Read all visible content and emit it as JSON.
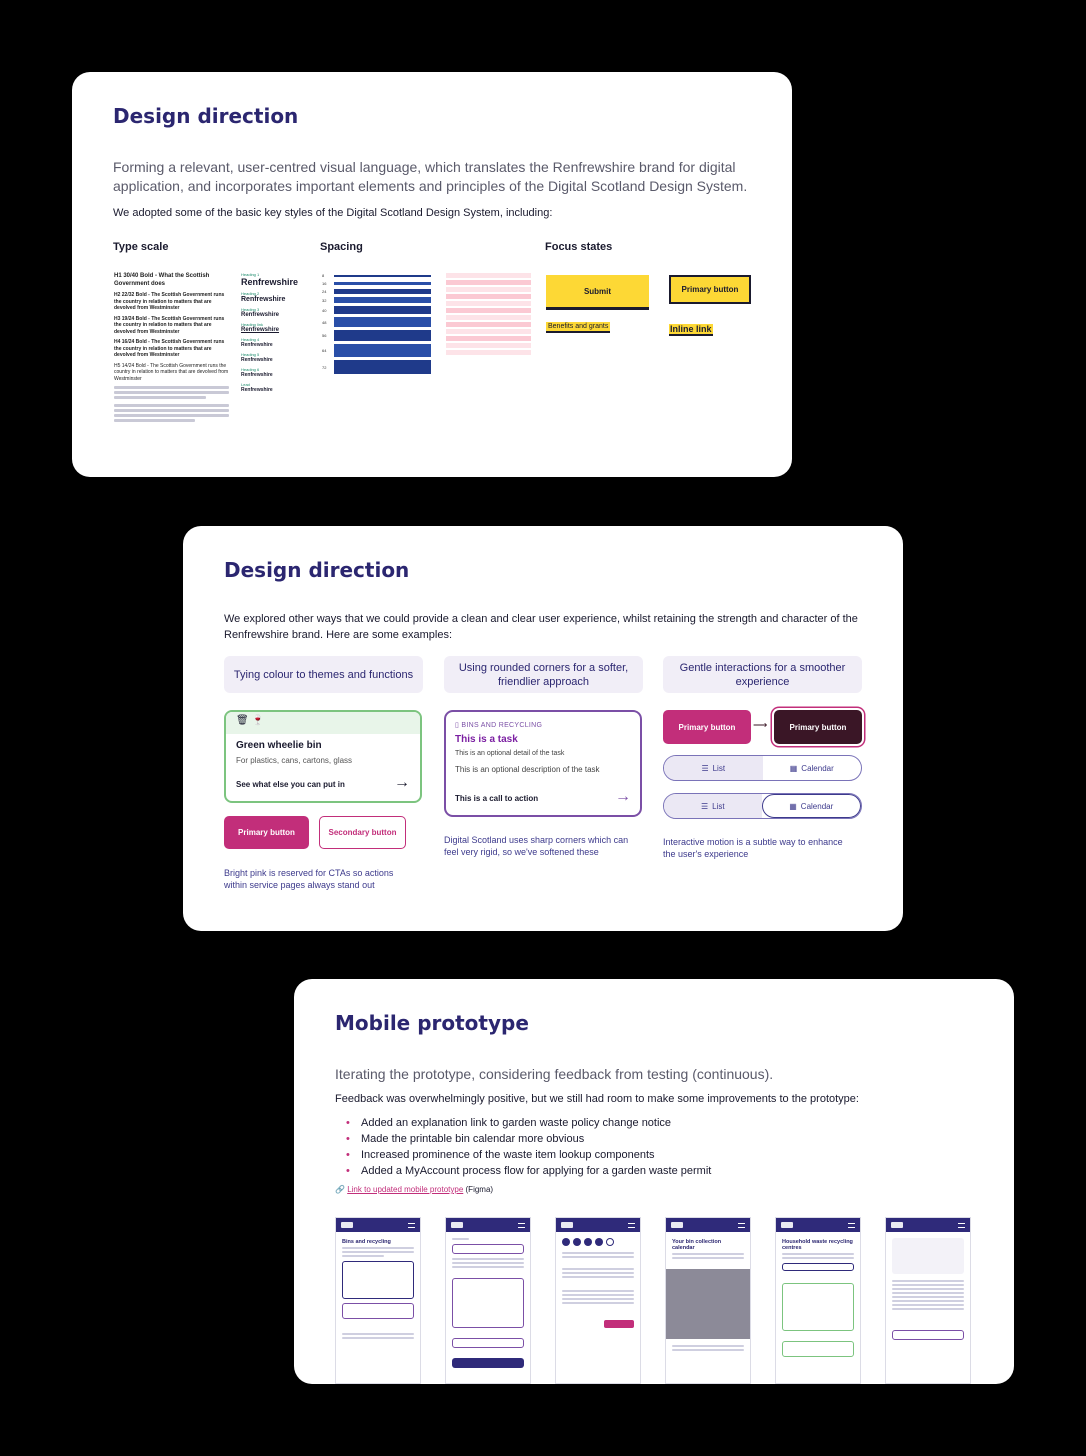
{
  "card1": {
    "title": "Design direction",
    "lead": "Forming a relevant, user-centred visual language, which translates the Renfrewshire brand for digital application, and incorporates important elements and principles of the Digital Scotland Design System.",
    "intro": "We adopted some of the basic key styles of the Digital Scotland Design System, including:",
    "type_scale_heading": "Type scale",
    "spacing_heading": "Spacing",
    "focus_heading": "Focus states",
    "type_scale_samples": [
      "H1 30/40 Bold - What the Scottish Government does",
      "H2 22/32 Bold - The Scottish Government runs the country in relation to matters that are devolved from Westminster",
      "H3 19/24 Bold - The Scottish Government runs the country in relation to matters that are devolved from Westminster",
      "H4 16/24 Bold - The Scottish Government runs the country in relation to matters that are devolved from Westminster",
      "H5 14/24 Bold - The Scottish Government runs the country in relation to matters that are devolved from Westminster"
    ],
    "renfrewshire_samples": [
      {
        "label": "Heading 1",
        "value": "Renfrewshire"
      },
      {
        "label": "Heading 2",
        "value": "Renfrewshire"
      },
      {
        "label": "Heading 3",
        "value": "Renfrewshire"
      },
      {
        "label": "Heading link",
        "value": "Renfrewshire"
      },
      {
        "label": "Heading 4",
        "value": "Renfrewshire"
      },
      {
        "label": "Heading 5",
        "value": "Renfrewshire"
      },
      {
        "label": "Heading 6",
        "value": "Renfrewshire"
      },
      {
        "label": "Lead",
        "value": "Renfrewshire"
      }
    ],
    "spacing_values": [
      "8",
      "16",
      "24",
      "32",
      "40",
      "48",
      "56",
      "64",
      "72"
    ],
    "focus": {
      "submit": "Submit",
      "primary": "Primary button",
      "benefits": "Benefits and grants",
      "inline": "Inline link"
    }
  },
  "card2": {
    "title": "Design direction",
    "intro": "We explored other ways that we could provide a clean and clear user experience, whilst retaining the strength and character of the Renfrewshire brand. Here are some examples:",
    "pills": [
      "Tying colour to themes and functions",
      "Using rounded corners for a softer, friendlier approach",
      "Gentle interactions for a smoother experience"
    ],
    "green_card": {
      "title": "Green wheelie bin",
      "subtitle": "For plastics, cans, cartons, glass",
      "link": "See what else you can put in"
    },
    "primary_button": "Primary button",
    "secondary_button": "Secondary button",
    "caption1": "Bright pink is reserved for CTAs so actions within service pages always stand out",
    "task": {
      "category": "BINS AND RECYCLING",
      "title": "This is a task",
      "detail": "This is an optional detail of the task",
      "description": "This is an optional description of the task",
      "cta": "This is a call to action"
    },
    "caption2": "Digital Scotland uses sharp corners which can feel very rigid, so we've softened these",
    "interaction": {
      "primary_a": "Primary button",
      "primary_b": "Primary button",
      "list": "List",
      "calendar": "Calendar"
    },
    "caption3": "Interactive motion is a subtle way to enhance the user's experience"
  },
  "card3": {
    "title": "Mobile prototype",
    "lead": "Iterating the prototype, considering feedback from testing (continuous).",
    "intro": "Feedback was overwhelmingly positive, but we still had room to make some improvements to the prototype:",
    "bullets": [
      "Added an explanation link to garden waste policy change notice",
      "Made the printable bin calendar more obvious",
      "Increased prominence of the waste item lookup components",
      "Added a MyAccount process flow for applying for a garden waste permit"
    ],
    "link_text": "Link to updated mobile prototype",
    "link_suffix": "(Figma)",
    "phones": [
      {
        "title": "Bins and recycling"
      },
      {
        "title": ""
      },
      {
        "title": ""
      },
      {
        "title": "Your bin collection calendar"
      },
      {
        "title": "Household waste recycling centres"
      },
      {
        "title": ""
      }
    ]
  },
  "colors": {
    "brand_purple": "#2b2670",
    "cta_pink": "#c22e7a",
    "focus_yellow": "#fdd835",
    "spacing_blue": "#1f3a8a"
  }
}
